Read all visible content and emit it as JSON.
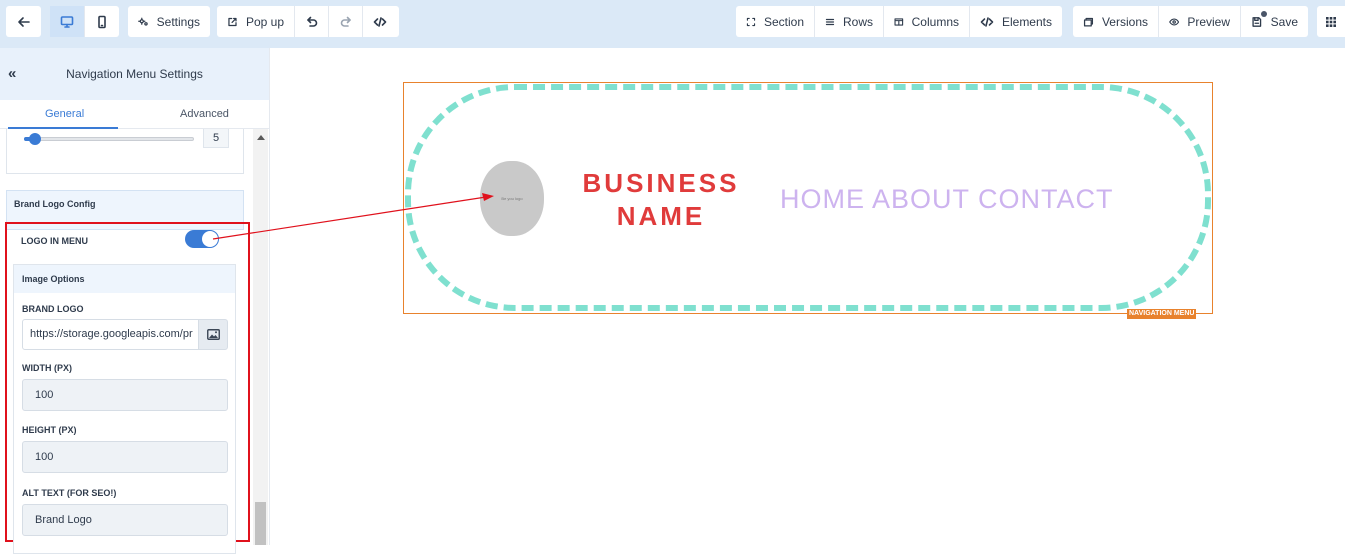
{
  "toolbar": {
    "settings_label": "Settings",
    "popup_label": "Pop up",
    "section_label": "Section",
    "rows_label": "Rows",
    "columns_label": "Columns",
    "elements_label": "Elements",
    "versions_label": "Versions",
    "preview_label": "Preview",
    "save_label": "Save"
  },
  "panel": {
    "title": "Navigation Menu Settings",
    "tabs": [
      {
        "label": "General",
        "active": true
      },
      {
        "label": "Advanced",
        "active": false
      }
    ],
    "slider_value": "5",
    "brand_logo_config_title": "Brand Logo Config",
    "logo_in_menu_label": "LOGO IN MENU",
    "logo_in_menu_enabled": true,
    "image_options_title": "Image Options",
    "brand_logo_label": "BRAND LOGO",
    "brand_logo_url": "https://storage.googleapis.com/pr",
    "width_label": "WIDTH (PX)",
    "width_value": "100",
    "height_label": "HEIGHT (PX)",
    "height_value": "100",
    "alt_label": "ALT TEXT (FOR SEO!)",
    "alt_value": "Brand Logo"
  },
  "canvas": {
    "logo_text": "Be you logo",
    "business_name": "BUSINESS NAME",
    "menu_links": "HOME ABOUT CONTACT",
    "element_tag": "NAVIGATION MENU"
  },
  "colors": {
    "accent": "#3a7bd5",
    "highlight_box": "#e0111c",
    "business_name": "#e03b3b",
    "menu_links": "#cdb3ef",
    "pill_border": "#7fe0cf",
    "frame": "#e8822d"
  }
}
